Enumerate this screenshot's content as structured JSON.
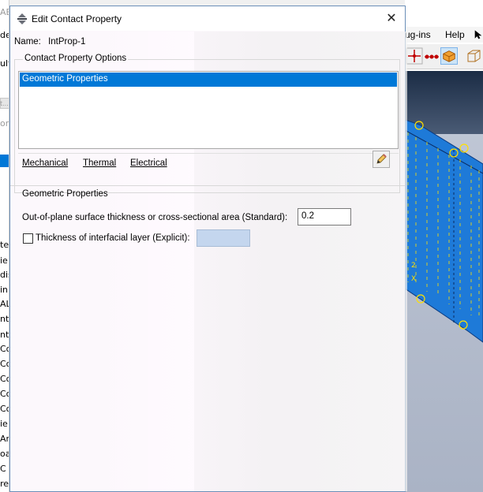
{
  "background_left": {
    "fragments": [
      "AE",
      "de",
      "ult",
      "t...",
      "on",
      "te",
      "ie",
      "dis",
      "in",
      "AL",
      "nte",
      "nte",
      "Co",
      "Co",
      "Co",
      "Co",
      "Co",
      "ie",
      "Am",
      "oa",
      "C",
      "re"
    ]
  },
  "background_right": {
    "menu_plugins": "ug-ins",
    "menu_help": "Help"
  },
  "dialog": {
    "title": "Edit Contact Property",
    "close_glyph": "✕",
    "name_label": "Name:",
    "name_value": "IntProp-1",
    "options_group_label": "Contact Property Options",
    "options_list": [
      "Geometric Properties"
    ],
    "tabs": [
      "Mechanical",
      "Thermal",
      "Electrical"
    ],
    "section_title": "Geometric Properties",
    "thickness_label": "Out-of-plane surface thickness or cross-sectional area (Standard):",
    "thickness_value": "0.2",
    "interfacial_label": "Thickness of interfacial layer (Explicit):",
    "interfacial_checked": false,
    "interfacial_value": ""
  },
  "colors": {
    "selection": "#0078d7",
    "model_blue": "#1e7ad8",
    "node_marker": "#ffe000",
    "disabled_field": "#c4d6ee"
  }
}
